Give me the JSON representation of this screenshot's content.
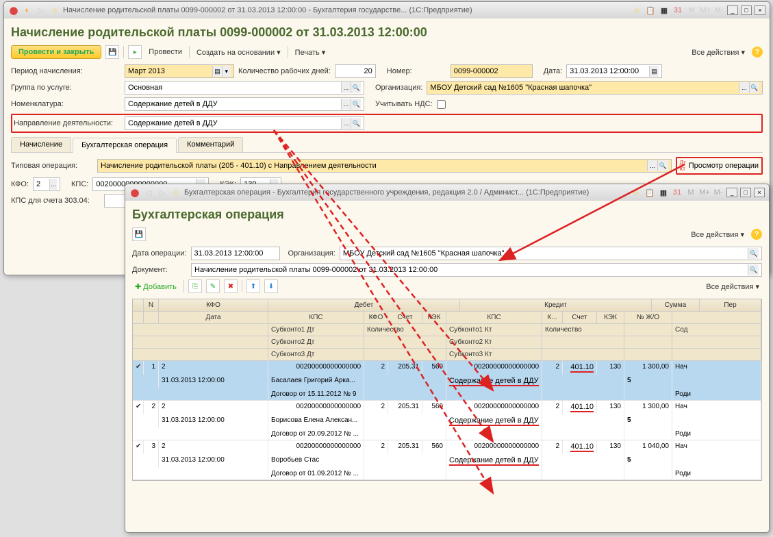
{
  "win1": {
    "title": "Начисление родительской платы 0099-000002 от 31.03.2013 12:00:00 - Бухгалтерия государстве... (1С:Предприятие)",
    "doc_title": "Начисление родительской платы 0099-000002 от 31.03.2013 12:00:00",
    "toolbar": {
      "post_close": "Провести и закрыть",
      "post": "Провести",
      "create_based": "Создать на основании",
      "print": "Печать",
      "all_actions": "Все действия"
    },
    "fields": {
      "period_lbl": "Период начисления:",
      "period_val": "Март 2013",
      "workdays_lbl": "Количество рабочих дней:",
      "workdays_val": "20",
      "number_lbl": "Номер:",
      "number_val": "0099-000002",
      "date_lbl": "Дата:",
      "date_val": "31.03.2013 12:00:00",
      "group_lbl": "Группа по услуге:",
      "group_val": "Основная",
      "org_lbl": "Организация:",
      "org_val": "МБОУ Детский сад №1605 \"Красная шапочка\"",
      "nomen_lbl": "Номенклатура:",
      "nomen_val": "Содержание детей в ДДУ",
      "vat_lbl": "Учитывать НДС:",
      "direction_lbl": "Направление деятельности:",
      "direction_val": "Содержание детей в ДДУ"
    },
    "tabs": {
      "t1": "Начисление",
      "t2": "Бухгалтерская операция",
      "t3": "Комментарий"
    },
    "op": {
      "type_lbl": "Типовая операция:",
      "type_val": "Начисление родительской платы (205 - 401.10) с Направлением деятельности",
      "view_op": "Просмотр операции",
      "kfo_lbl": "КФО:",
      "kfo_val": "2",
      "kps_lbl": "КПС:",
      "kps_val": "00200000000000000",
      "kek_lbl": "КЭК:",
      "kek_val": "130",
      "kps303_lbl": "КПС для счета 303.04:"
    }
  },
  "win2": {
    "title": "Бухгалтерская операция - Бухгалтерия государственного учреждения, редакция 2.0 / Админист... (1С:Предприятие)",
    "doc_title": "Бухгалтерская операция",
    "toolbar": {
      "all_actions": "Все действия"
    },
    "fields": {
      "opdate_lbl": "Дата операции:",
      "opdate_val": "31.03.2013 12:00:00",
      "org_lbl": "Организация:",
      "org_val": "МБОУ Детский сад №1605 \"Красная шапочка\"",
      "doc_lbl": "Документ:",
      "doc_val": "Начисление родительской платы 0099-000002 от 31.03.2013 12:00:00"
    },
    "subtoolbar": {
      "add": "Добавить",
      "all_actions": "Все действия"
    },
    "grid": {
      "hdr": {
        "n": "N",
        "kfo": "КФО",
        "debit": "Дебет",
        "credit": "Кредит",
        "sum": "Сумма",
        "per": "Пер",
        "date": "Дата",
        "kps": "КПС",
        "kfo2": "КФО",
        "acct": "Счет",
        "kek": "КЭК",
        "kps2": "КПС",
        "k": "К...",
        "acct2": "Счет",
        "kek2": "КЭК",
        "jo": "№ Ж/О",
        "sub1d": "Субконто1 Дт",
        "sub2d": "Субконто2 Дт",
        "sub3d": "Субконто3 Дт",
        "qty": "Количество",
        "sub1k": "Субконто1 Кт",
        "sub2k": "Субконто2 Кт",
        "sub3k": "Субконто3 Кт",
        "qty2": "Количество",
        "sod": "Сод"
      },
      "rows": [
        {
          "n": "1",
          "kfo": "2",
          "date": "31.03.2013 12:00:00",
          "kps_d": "00200000000000000",
          "sub1d": "Басалаев Григорий Арка...",
          "sub2d": "Договор от 15.11.2012 № 9",
          "kfo_d": "2",
          "acct_d": "205.31",
          "kek_d": "560",
          "kps_k": "00200000000000000",
          "sub1k": "Содержание детей в ДДУ",
          "kfo_k": "2",
          "acct_k": "401.10",
          "kek_k": "130",
          "sum": "1 300,00",
          "jo": "5",
          "op": "Нач",
          "op2": "Роди"
        },
        {
          "n": "2",
          "kfo": "2",
          "date": "31.03.2013 12:00:00",
          "kps_d": "00200000000000000",
          "sub1d": "Борисова Елена Алексан...",
          "sub2d": "Договор от 20.09.2012 № ...",
          "kfo_d": "2",
          "acct_d": "205.31",
          "kek_d": "560",
          "kps_k": "00200000000000000",
          "sub1k": "Содержание детей в ДДУ",
          "kfo_k": "2",
          "acct_k": "401.10",
          "kek_k": "130",
          "sum": "1 300,00",
          "jo": "5",
          "op": "Нач",
          "op2": "Роди"
        },
        {
          "n": "3",
          "kfo": "2",
          "date": "31.03.2013 12:00:00",
          "kps_d": "00200000000000000",
          "sub1d": "Воробьев Стас",
          "sub2d": "Договор от 01.09.2012 № ...",
          "kfo_d": "2",
          "acct_d": "205.31",
          "kek_d": "560",
          "kps_k": "00200000000000000",
          "sub1k": "Содержание детей в ДДУ",
          "kfo_k": "2",
          "acct_k": "401.10",
          "kek_k": "130",
          "sum": "1 040,00",
          "jo": "5",
          "op": "Нач",
          "op2": "Роди"
        }
      ]
    }
  }
}
